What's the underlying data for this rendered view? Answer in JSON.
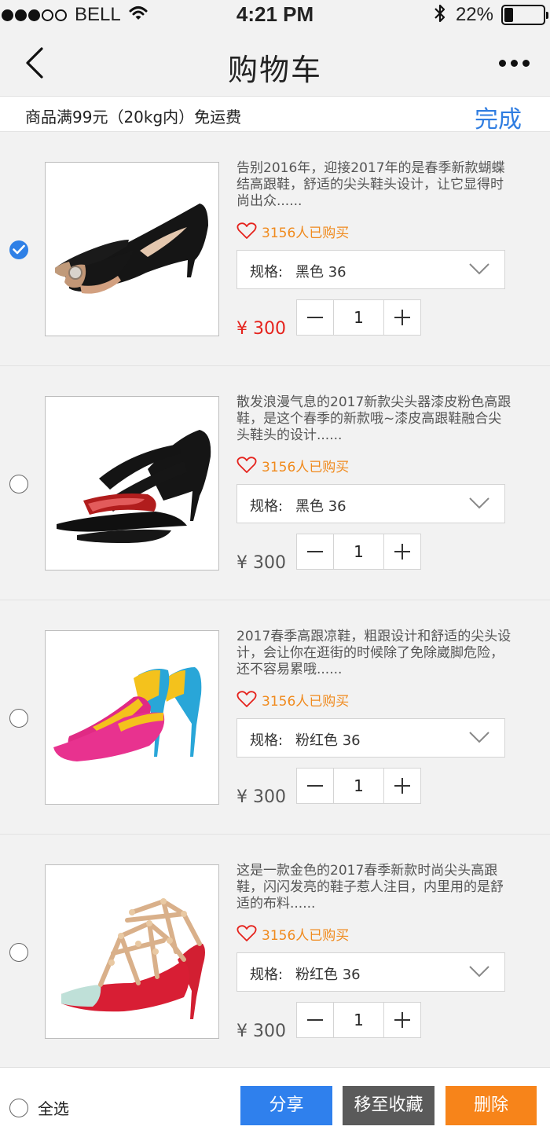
{
  "status_bar": {
    "carrier": "BELL",
    "time": "4:21 PM",
    "battery": "22%",
    "battery_level": 0.22,
    "signal_bars": 3,
    "signal_total": 5
  },
  "nav": {
    "title": "购物车",
    "back_icon": "chevron-left-icon",
    "more_icon": "more-icon"
  },
  "notice": {
    "text": "商品满99元（20kg内）免运费",
    "done_label": "完成"
  },
  "items": [
    {
      "selected": true,
      "description": "告别2016年，迎接2017年的是春季新款蝴蝶结高跟鞋，舒适的尖头鞋头设计，让它显得时尚出众......",
      "buyers": "3156人已购买",
      "spec_label": "规格:",
      "spec_value": "黑色  36",
      "quantity": "1",
      "price": "¥ 300"
    },
    {
      "selected": false,
      "description": "散发浪漫气息的2017新款尖头器漆皮粉色高跟鞋，是这个春季的新款哦~漆皮高跟鞋融合尖头鞋头的设计......",
      "buyers": "3156人已购买",
      "spec_label": "规格:",
      "spec_value": "黑色  36",
      "quantity": "1",
      "price": "¥ 300"
    },
    {
      "selected": false,
      "description": "2017春季高跟凉鞋，粗跟设计和舒适的尖头设计，会让你在逛街的时候除了免除崴脚危险，还不容易累哦......",
      "buyers": "3156人已购买",
      "spec_label": "规格:",
      "spec_value": "粉红色  36",
      "quantity": "1",
      "price": "¥ 300"
    },
    {
      "selected": false,
      "description": "这是一款金色的2017春季新款时尚尖头高跟鞋，闪闪发亮的鞋子惹人注目，内里用的是舒适的布料......",
      "buyers": "3156人已购买",
      "spec_label": "规格:",
      "spec_value": "粉红色  36",
      "quantity": "1",
      "price": "¥ 300"
    }
  ],
  "bottom": {
    "select_all": "全选",
    "share": "分享",
    "favorite": "移至收藏",
    "delete": "删除"
  },
  "colors": {
    "accent_blue": "#2f80ed",
    "price_red": "#e5231d",
    "buyers_orange": "#f08a1d",
    "delete_orange": "#f7841a",
    "favorite_gray": "#5a5a5a"
  }
}
